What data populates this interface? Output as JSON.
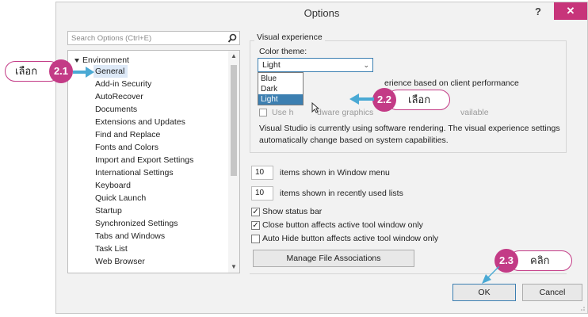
{
  "window": {
    "title": "Options",
    "help_label": "?",
    "close_label": "✕"
  },
  "search": {
    "placeholder": "Search Options (Ctrl+E)",
    "icon": "search-icon"
  },
  "tree": {
    "root_label": "Environment",
    "items": [
      "General",
      "Add-in Security",
      "AutoRecover",
      "Documents",
      "Extensions and Updates",
      "Find and Replace",
      "Fonts and Colors",
      "Import and Export Settings",
      "International Settings",
      "Keyboard",
      "Quick Launch",
      "Startup",
      "Synchronized Settings",
      "Tabs and Windows",
      "Task List",
      "Web Browser"
    ],
    "selected": "General",
    "scroll_up": "▲",
    "scroll_down": "▼"
  },
  "visual": {
    "group_label": "Visual experience",
    "theme_label": "Color theme:",
    "theme_value": "Light",
    "theme_options": [
      "Blue",
      "Dark",
      "Light"
    ],
    "theme_selected": "Light",
    "auto_adjust_partial": "erience based on client performance",
    "hw_graphics_partial": "Use h",
    "hw_graphics_partial2": "dware graphics",
    "hw_available_partial": "vailable",
    "info_line1": "Visual Studio is currently using software rendering.  The visual experience settings",
    "info_line2": "automatically change based on system capabilities."
  },
  "window_menu": {
    "value": "10",
    "label": "items shown in Window menu"
  },
  "recent_lists": {
    "value": "10",
    "label": "items shown in recently used lists"
  },
  "checkboxes": [
    {
      "label": "Show status bar",
      "checked": true
    },
    {
      "label": "Close button affects active tool window only",
      "checked": true
    },
    {
      "label": "Auto Hide button affects active tool window only",
      "checked": false
    }
  ],
  "check_mark": "✓",
  "manage_button": "Manage File Associations",
  "ok_button": "OK",
  "cancel_button": "Cancel",
  "annotations": {
    "a21": {
      "number": "2.1",
      "text": "เลือก"
    },
    "a22": {
      "number": "2.2",
      "text": "เลือก"
    },
    "a23": {
      "number": "2.3",
      "text": "คลิก"
    }
  },
  "colors": {
    "accent": "#3c7fb1",
    "callout": "#c33b86",
    "close": "#c7347a",
    "arrow": "#4aa9d4"
  }
}
